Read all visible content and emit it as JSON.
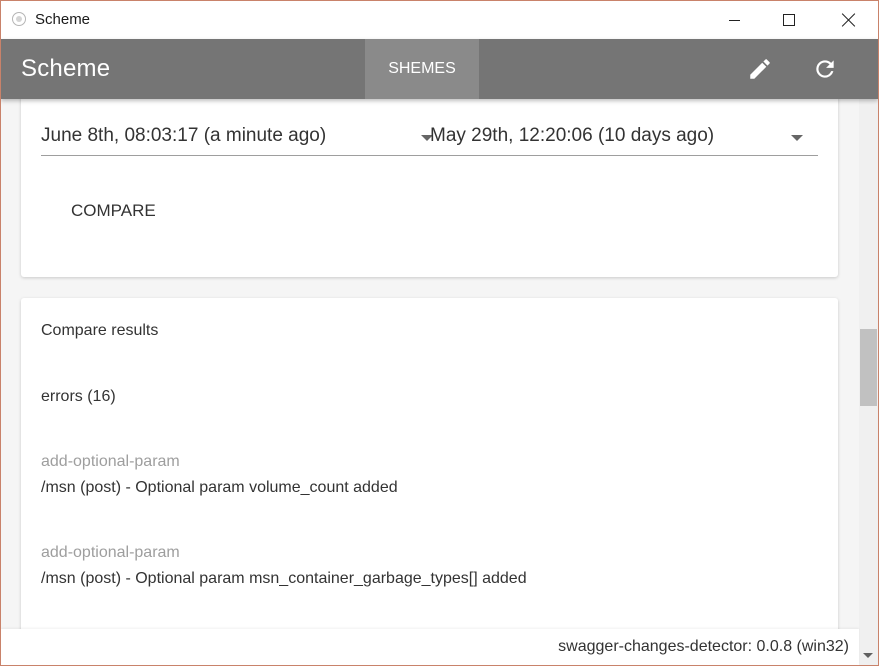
{
  "window": {
    "title": "Scheme"
  },
  "appbar": {
    "title": "Scheme",
    "tab_label": "SHEMES",
    "edit_icon": "pencil-icon",
    "refresh_icon": "refresh-icon"
  },
  "selector": {
    "left_value": "June 8th, 08:03:17 (a minute ago)",
    "right_value": "May 29th, 12:20:06 (10 days ago)",
    "compare_label": "COMPARE"
  },
  "results": {
    "heading": "Compare results",
    "errors_label": "errors (16)",
    "items": [
      {
        "type": "add-optional-param",
        "description": "/msn (post) - Optional param volume_count added"
      },
      {
        "type": "add-optional-param",
        "description": "/msn (post) - Optional param msn_container_garbage_types[] added"
      }
    ]
  },
  "footer": {
    "version": "swagger-changes-detector: 0.0.8 (win32)"
  },
  "colors": {
    "appbar": "#757575",
    "tab_active": "#8a8a8a",
    "muted_text": "#9e9e9e"
  }
}
